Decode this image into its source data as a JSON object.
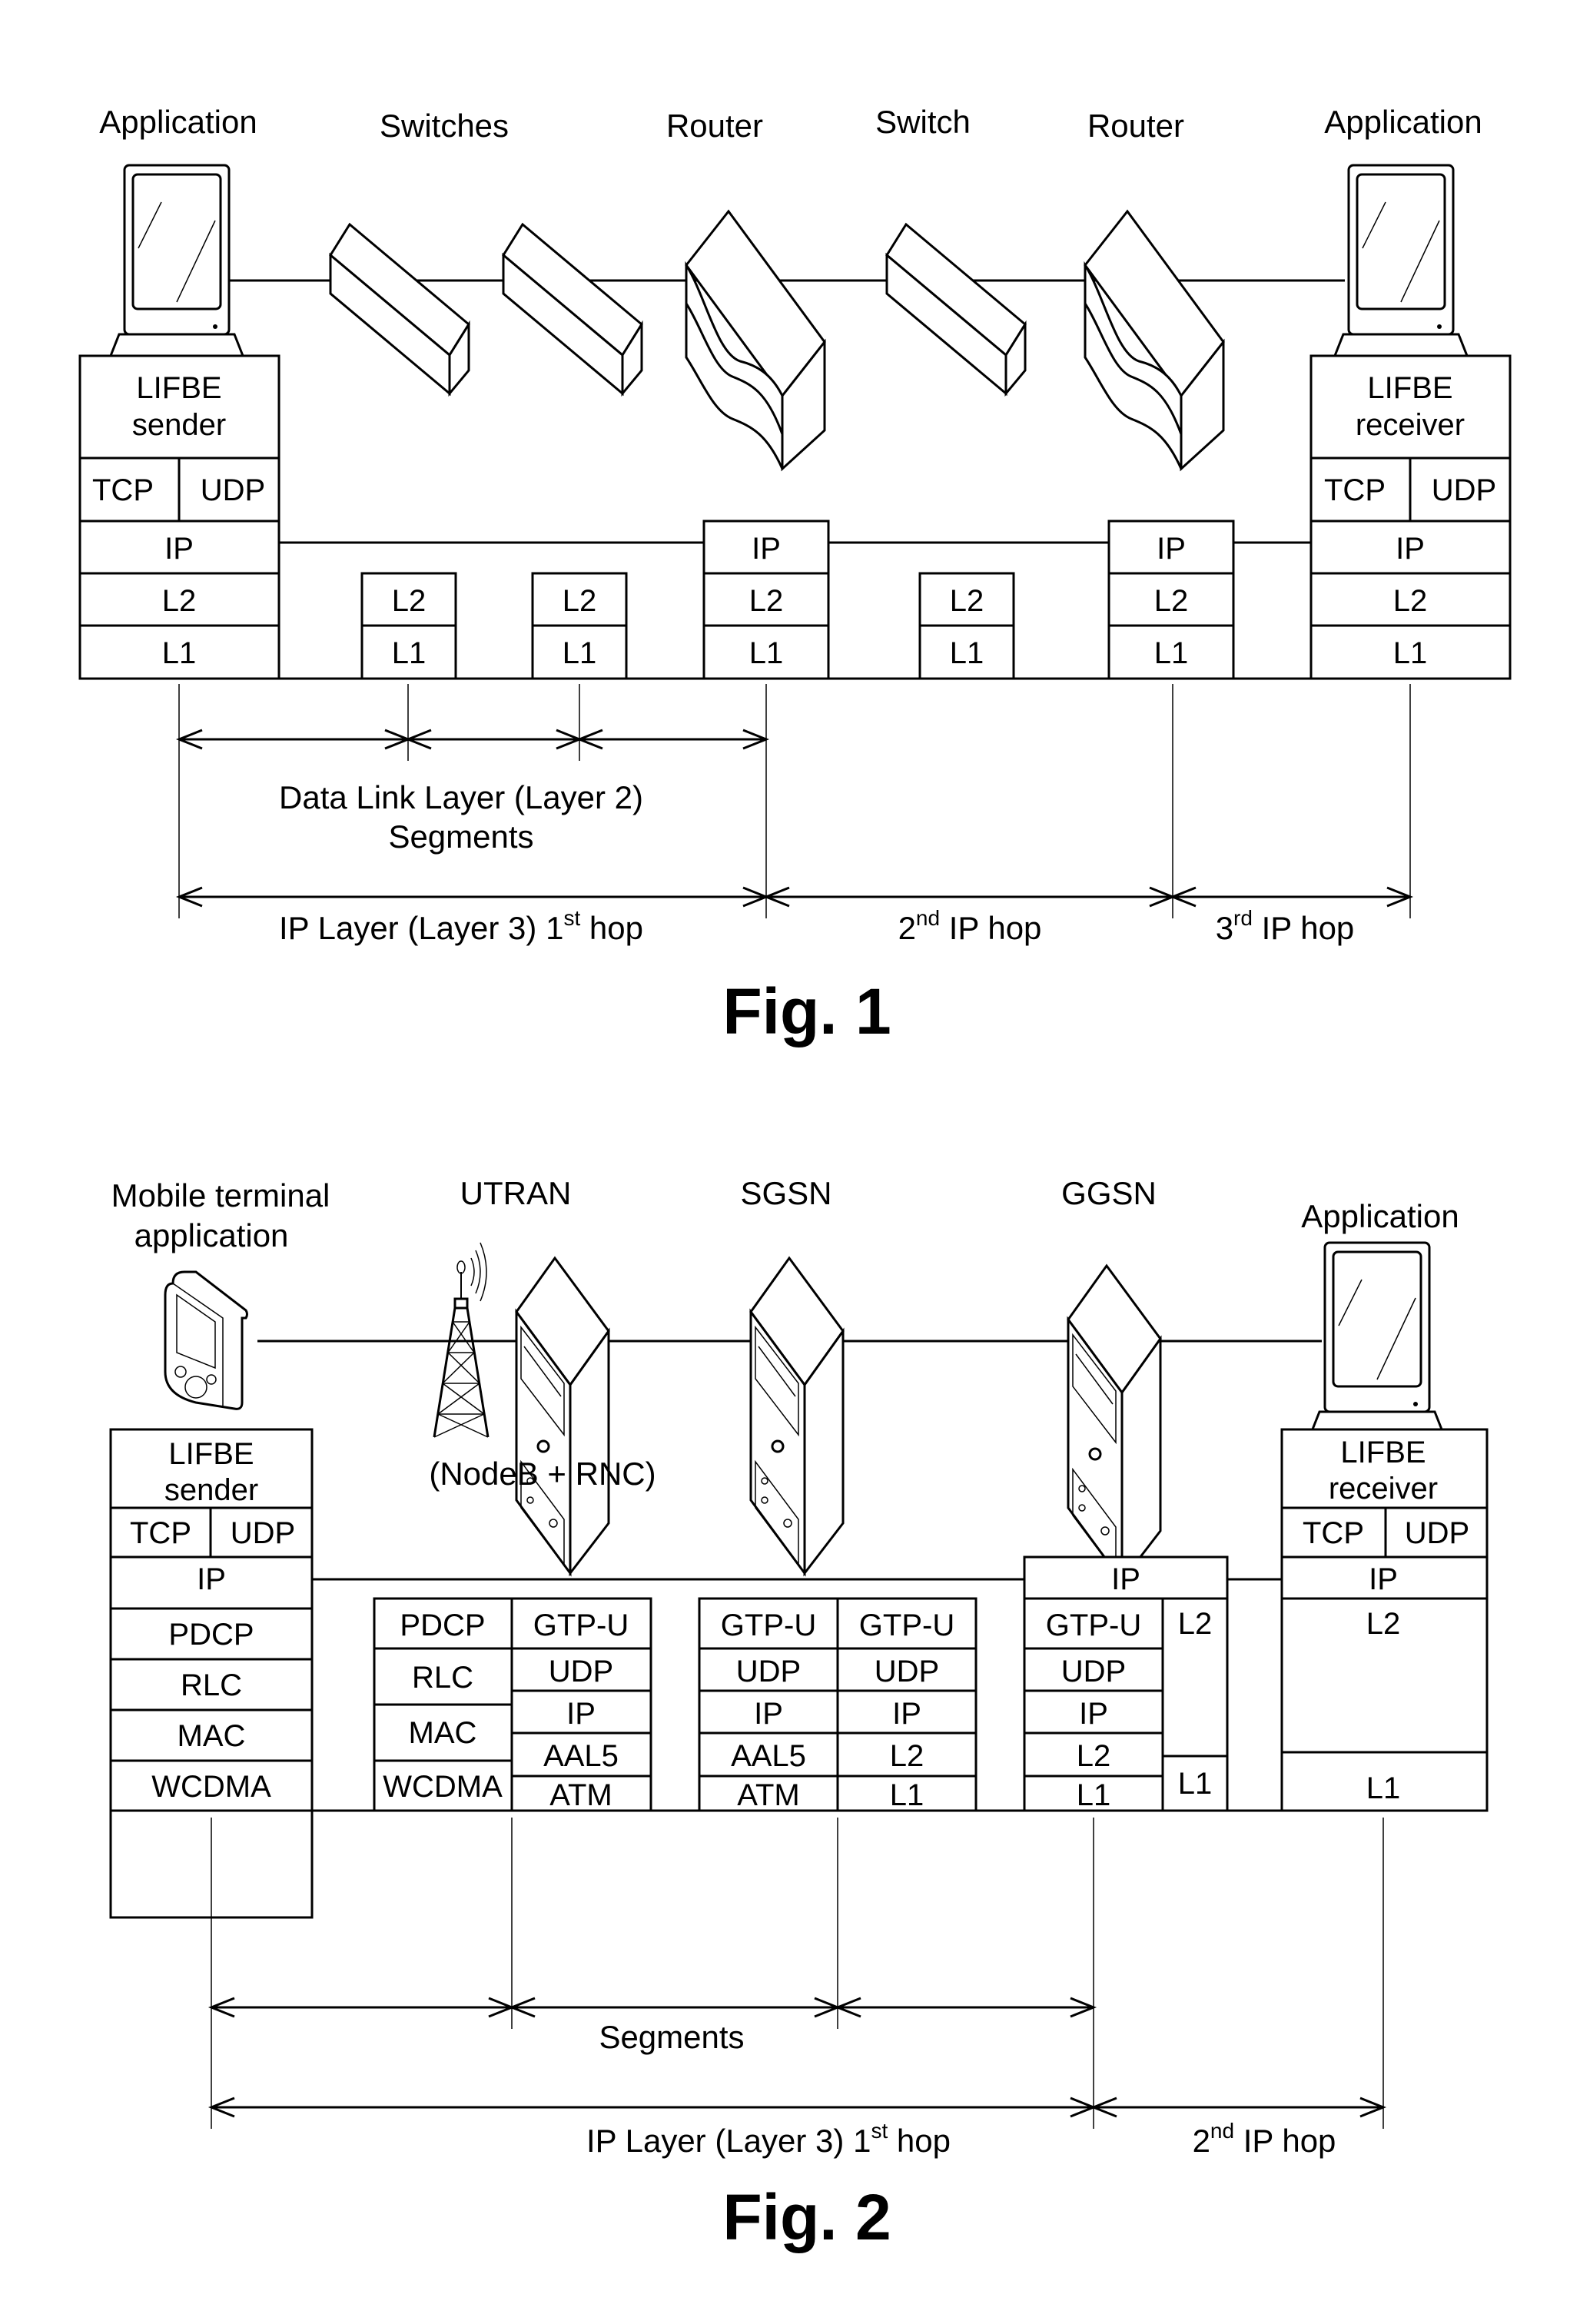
{
  "figures": [
    {
      "id": "fig1",
      "caption": "Fig. 1",
      "device_labels": [
        "Application",
        "Switches",
        "Router",
        "Switch",
        "Router",
        "Application"
      ],
      "devices": [
        "computer",
        "switch",
        "switch",
        "router",
        "switch",
        "router",
        "computer"
      ],
      "sender_stack": {
        "title_line1": "LIFBE",
        "title_line2": "sender",
        "layers": [
          [
            "TCP",
            "UDP"
          ],
          [
            "IP"
          ],
          [
            "L2"
          ],
          [
            "L1"
          ]
        ]
      },
      "receiver_stack": {
        "title_line1": "LIFBE",
        "title_line2": "receiver",
        "layers": [
          [
            "TCP",
            "UDP"
          ],
          [
            "IP"
          ],
          [
            "L2"
          ],
          [
            "L1"
          ]
        ]
      },
      "intermediate_stacks": [
        {
          "node": "switch-1",
          "layers": [
            "L2",
            "L1"
          ]
        },
        {
          "node": "switch-2",
          "layers": [
            "L2",
            "L1"
          ]
        },
        {
          "node": "router-1",
          "layers": [
            "IP",
            "L2",
            "L1"
          ]
        },
        {
          "node": "switch-3",
          "layers": [
            "L2",
            "L1"
          ]
        },
        {
          "node": "router-2",
          "layers": [
            "IP",
            "L2",
            "L1"
          ]
        }
      ],
      "spans": {
        "segments_label_line1": "Data Link Layer (Layer 2)",
        "segments_label_line2": "Segments",
        "hop1": {
          "text": "IP Layer (Layer 3) 1",
          "sup": "st",
          "tail": " hop"
        },
        "hop2": {
          "text": "2",
          "sup": "nd",
          "tail": " IP hop"
        },
        "hop3": {
          "text": "3",
          "sup": "rd",
          "tail": " IP hop"
        }
      }
    },
    {
      "id": "fig2",
      "caption": "Fig. 2",
      "device_labels": {
        "mobile_line1": "Mobile terminal",
        "mobile_line2": "application",
        "utran": "UTRAN",
        "utran_sub": "(NodeB + RNC)",
        "sgsn": "SGSN",
        "ggsn": "GGSN",
        "application": "Application"
      },
      "sender_stack": {
        "title_line1": "LIFBE",
        "title_line2": "sender",
        "layers": [
          [
            "TCP",
            "UDP"
          ],
          [
            "IP"
          ],
          [
            "PDCP"
          ],
          [
            "RLC"
          ],
          [
            "MAC"
          ],
          [
            "WCDMA"
          ]
        ]
      },
      "utran_stack": {
        "left": [
          "PDCP",
          "RLC",
          "MAC",
          "WCDMA"
        ],
        "right": [
          "GTP-U",
          "UDP",
          "IP",
          "AAL5",
          "ATM"
        ]
      },
      "sgsn_stack": {
        "left": [
          "GTP-U",
          "UDP",
          "IP",
          "AAL5",
          "ATM"
        ],
        "right": [
          "GTP-U",
          "UDP",
          "IP",
          "L2",
          "L1"
        ]
      },
      "ggsn_stack": {
        "top": "IP",
        "left": [
          "GTP-U",
          "UDP",
          "IP",
          "L2",
          "L1"
        ],
        "right": [
          "L2",
          "L1"
        ]
      },
      "receiver_stack": {
        "title_line1": "LIFBE",
        "title_line2": "receiver",
        "layers": [
          [
            "TCP",
            "UDP"
          ],
          [
            "IP"
          ],
          [
            "L2"
          ],
          [
            "L1"
          ]
        ]
      },
      "spans": {
        "segments_label": "Segments",
        "hop1": {
          "text": "IP Layer (Layer 3) 1",
          "sup": "st",
          "tail": " hop"
        },
        "hop2": {
          "text": "2",
          "sup": "nd",
          "tail": " IP hop"
        }
      }
    }
  ]
}
